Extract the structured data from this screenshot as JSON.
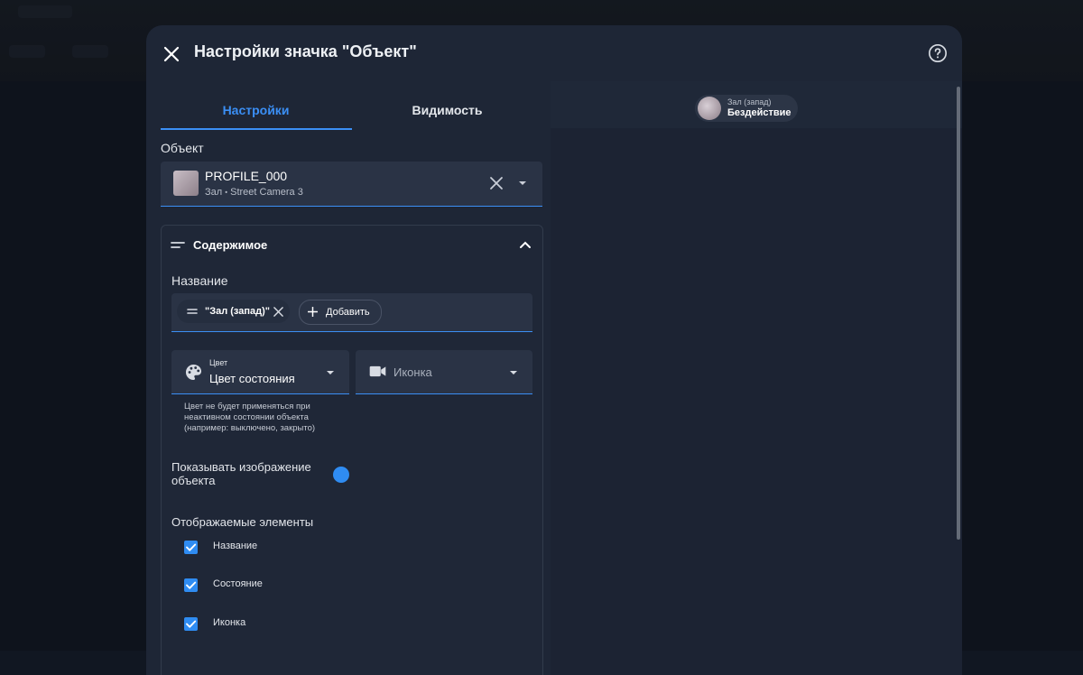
{
  "dialog": {
    "title": "Настройки значка \"Объект\"",
    "tabs": [
      {
        "label": "Настройки",
        "active": true
      },
      {
        "label": "Видимость",
        "active": false
      }
    ]
  },
  "object": {
    "label": "Объект",
    "name": "PROFILE_000",
    "location": "Зал",
    "camera": "Street Camera 3"
  },
  "content_section": {
    "title": "Содержимое",
    "name_label": "Название",
    "name_chip": "\"Зал (запад)\"",
    "add_label": "Добавить",
    "color": {
      "label": "Цвет",
      "value": "Цвет состояния"
    },
    "icon_placeholder": "Иконка",
    "hint": "Цвет не будет применяться при неактивном состоянии объекта (например: выключено, закрыто)",
    "show_image_label": "Показывать изображение объекта",
    "elements_label": "Отображаемые элементы",
    "elements": [
      {
        "label": "Название",
        "checked": true
      },
      {
        "label": "Состояние",
        "checked": true
      },
      {
        "label": "Иконка",
        "checked": true
      }
    ]
  },
  "preview": {
    "sub": "Зал (запад)",
    "status": "Бездействие"
  },
  "colors": {
    "accent": "#3b8ff5",
    "panel": "#1e2636"
  }
}
